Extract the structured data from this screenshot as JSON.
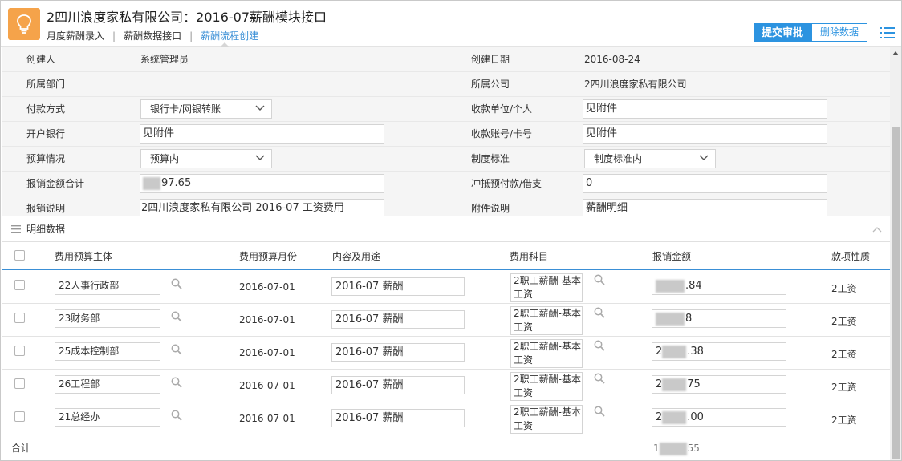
{
  "header": {
    "title": "2四川浪度家私有限公司：2016-07薪酬模块接口",
    "nav": [
      {
        "label": "月度薪酬录入",
        "active": false
      },
      {
        "label": "薪酬数据接口",
        "active": false
      },
      {
        "label": "薪酬流程创建",
        "active": true
      }
    ],
    "submit_label": "提交审批",
    "delete_label": "删除数据",
    "accent": "#2c93e0",
    "logo_color": "#f5a34a",
    "logo_icon": "lightbulb-icon"
  },
  "form": {
    "creator_label": "创建人",
    "creator_value": "系统管理员",
    "created_date_label": "创建日期",
    "created_date_value": "2016-08-24",
    "department_label": "所属部门",
    "department_value": "",
    "company_label": "所属公司",
    "company_value": "2四川浪度家私有限公司",
    "payment_method_label": "付款方式",
    "payment_method_value": "银行卡/网银转账",
    "payee_label": "收款单位/个人",
    "payee_value": "见附件",
    "bank_label": "开户银行",
    "bank_value": "见附件",
    "account_label": "收款账号/卡号",
    "account_value": "见附件",
    "budget_label": "预算情况",
    "budget_value": "预算内",
    "standard_label": "制度标准",
    "standard_value": "制度标准内",
    "amount_label": "报销金额合计",
    "amount_value": "97.65",
    "offset_label": "冲抵预付款/借支",
    "offset_value": "0",
    "desc_label": "报销说明",
    "desc_value": "2四川浪度家私有限公司 2016-07 工资费用",
    "attach_label": "附件说明",
    "attach_value": "薪酬明细"
  },
  "detail": {
    "title": "明细数据",
    "columns": [
      "费用预算主体",
      "费用预算月份",
      "内容及用途",
      "费用科目",
      "报销金额",
      "款项性质"
    ],
    "rows": [
      {
        "entity": "22人事行政部",
        "month": "2016-07-01",
        "purpose": "2016-07 薪酬",
        "subject": "2职工薪酬-基本工资",
        "amount_prefix": "",
        "amount": ".84",
        "nature": "2工资"
      },
      {
        "entity": "23财务部",
        "month": "2016-07-01",
        "purpose": "2016-07 薪酬",
        "subject": "2职工薪酬-基本工资",
        "amount_prefix": "",
        "amount": "8",
        "nature": "2工资"
      },
      {
        "entity": "25成本控制部",
        "month": "2016-07-01",
        "purpose": "2016-07 薪酬",
        "subject": "2职工薪酬-基本工资",
        "amount_prefix": "2",
        "amount": ".38",
        "nature": "2工资"
      },
      {
        "entity": "26工程部",
        "month": "2016-07-01",
        "purpose": "2016-07 薪酬",
        "subject": "2职工薪酬-基本工资",
        "amount_prefix": "2",
        "amount": "75",
        "nature": "2工资"
      },
      {
        "entity": "21总经办",
        "month": "2016-07-01",
        "purpose": "2016-07 薪酬",
        "subject": "2职工薪酬-基本工资",
        "amount_prefix": "2",
        "amount": ".00",
        "nature": "2工资"
      }
    ],
    "total_label": "合计",
    "total_prefix": "1",
    "total_value": "55"
  }
}
